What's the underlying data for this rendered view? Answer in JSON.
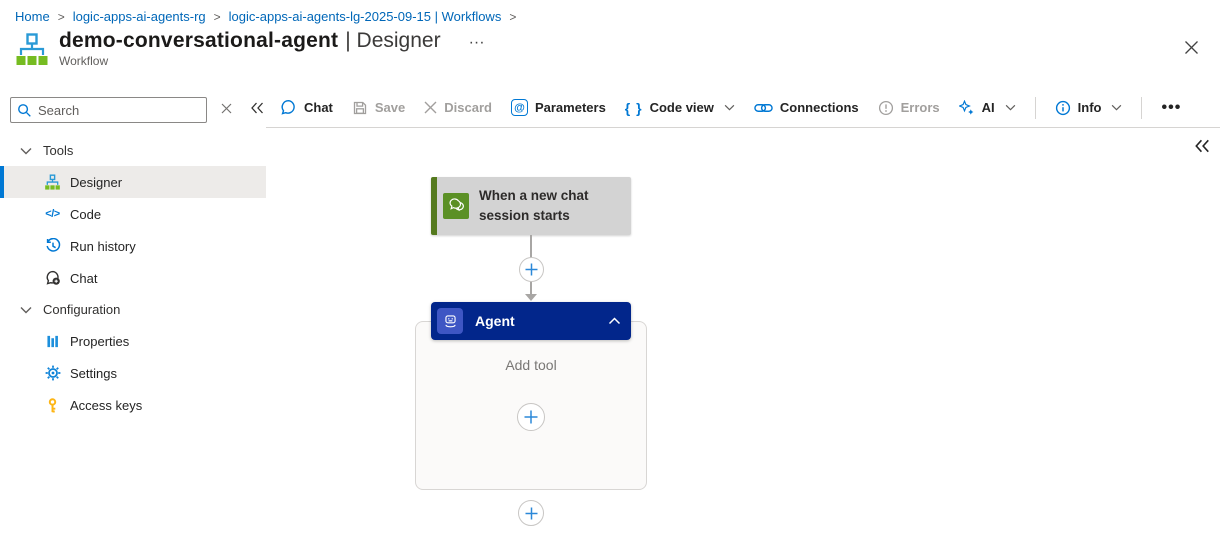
{
  "breadcrumb": {
    "separator": ">",
    "items": [
      {
        "label": "Home"
      },
      {
        "label": "logic-apps-ai-agents-rg"
      },
      {
        "label": "logic-apps-ai-agents-lg-2025-09-15 | Workflows"
      }
    ]
  },
  "header": {
    "title": "demo-conversational-agent",
    "title_suffix": "| Designer",
    "subtitle": "Workflow",
    "more_label": "···"
  },
  "sidebar": {
    "search": {
      "placeholder": "Search"
    },
    "groups": [
      {
        "label": "Tools",
        "items": [
          {
            "label": "Designer",
            "icon": "workflow-icon",
            "selected": true
          },
          {
            "label": "Code",
            "icon": "code-icon",
            "selected": false
          },
          {
            "label": "Run history",
            "icon": "run-history-icon",
            "selected": false
          },
          {
            "label": "Chat",
            "icon": "chat-add-icon",
            "selected": false
          }
        ]
      },
      {
        "label": "Configuration",
        "items": [
          {
            "label": "Properties",
            "icon": "properties-icon",
            "selected": false
          },
          {
            "label": "Settings",
            "icon": "settings-gear-icon",
            "selected": false
          },
          {
            "label": "Access keys",
            "icon": "key-icon",
            "selected": false
          }
        ]
      }
    ]
  },
  "toolbar": {
    "items": [
      {
        "label": "Chat",
        "icon": "chat-icon",
        "disabled": false,
        "dropdown": false
      },
      {
        "label": "Save",
        "icon": "save-icon",
        "disabled": true,
        "dropdown": false
      },
      {
        "label": "Discard",
        "icon": "discard-icon",
        "disabled": true,
        "dropdown": false
      },
      {
        "label": "Parameters",
        "icon": "parameters-at-icon",
        "disabled": false,
        "dropdown": false
      },
      {
        "label": "Code view",
        "icon": "code-view-braces-icon",
        "disabled": false,
        "dropdown": true
      },
      {
        "label": "Connections",
        "icon": "connections-link-icon",
        "disabled": false,
        "dropdown": false
      },
      {
        "label": "Errors",
        "icon": "errors-icon",
        "disabled": true,
        "dropdown": false
      },
      {
        "label": "AI",
        "icon": "ai-sparkle-icon",
        "disabled": false,
        "dropdown": true
      },
      {
        "label": "Info",
        "icon": "info-icon",
        "disabled": false,
        "dropdown": true
      }
    ],
    "more_label": "•••"
  },
  "icons": {
    "code_glyph": "</>",
    "parameters_glyph": "@",
    "code_view_glyph": "{ }"
  },
  "canvas": {
    "trigger": {
      "title_line1": "When a new chat",
      "title_line2": "session starts"
    },
    "agent": {
      "title": "Agent",
      "placeholder": "Add tool"
    }
  },
  "colors": {
    "accent_blue": "#0078d4",
    "link_blue": "#0067b8",
    "agent_header_blue": "#02268b",
    "agent_chip_blue": "#3e56c4",
    "trigger_bar_green": "#557a1e",
    "trigger_chip_green": "#5b9025",
    "key_gold": "#fdb515",
    "disabled_gray": "#a19f9d",
    "selected_bg": "#edebe9",
    "node_gray": "#d3d3d3"
  }
}
